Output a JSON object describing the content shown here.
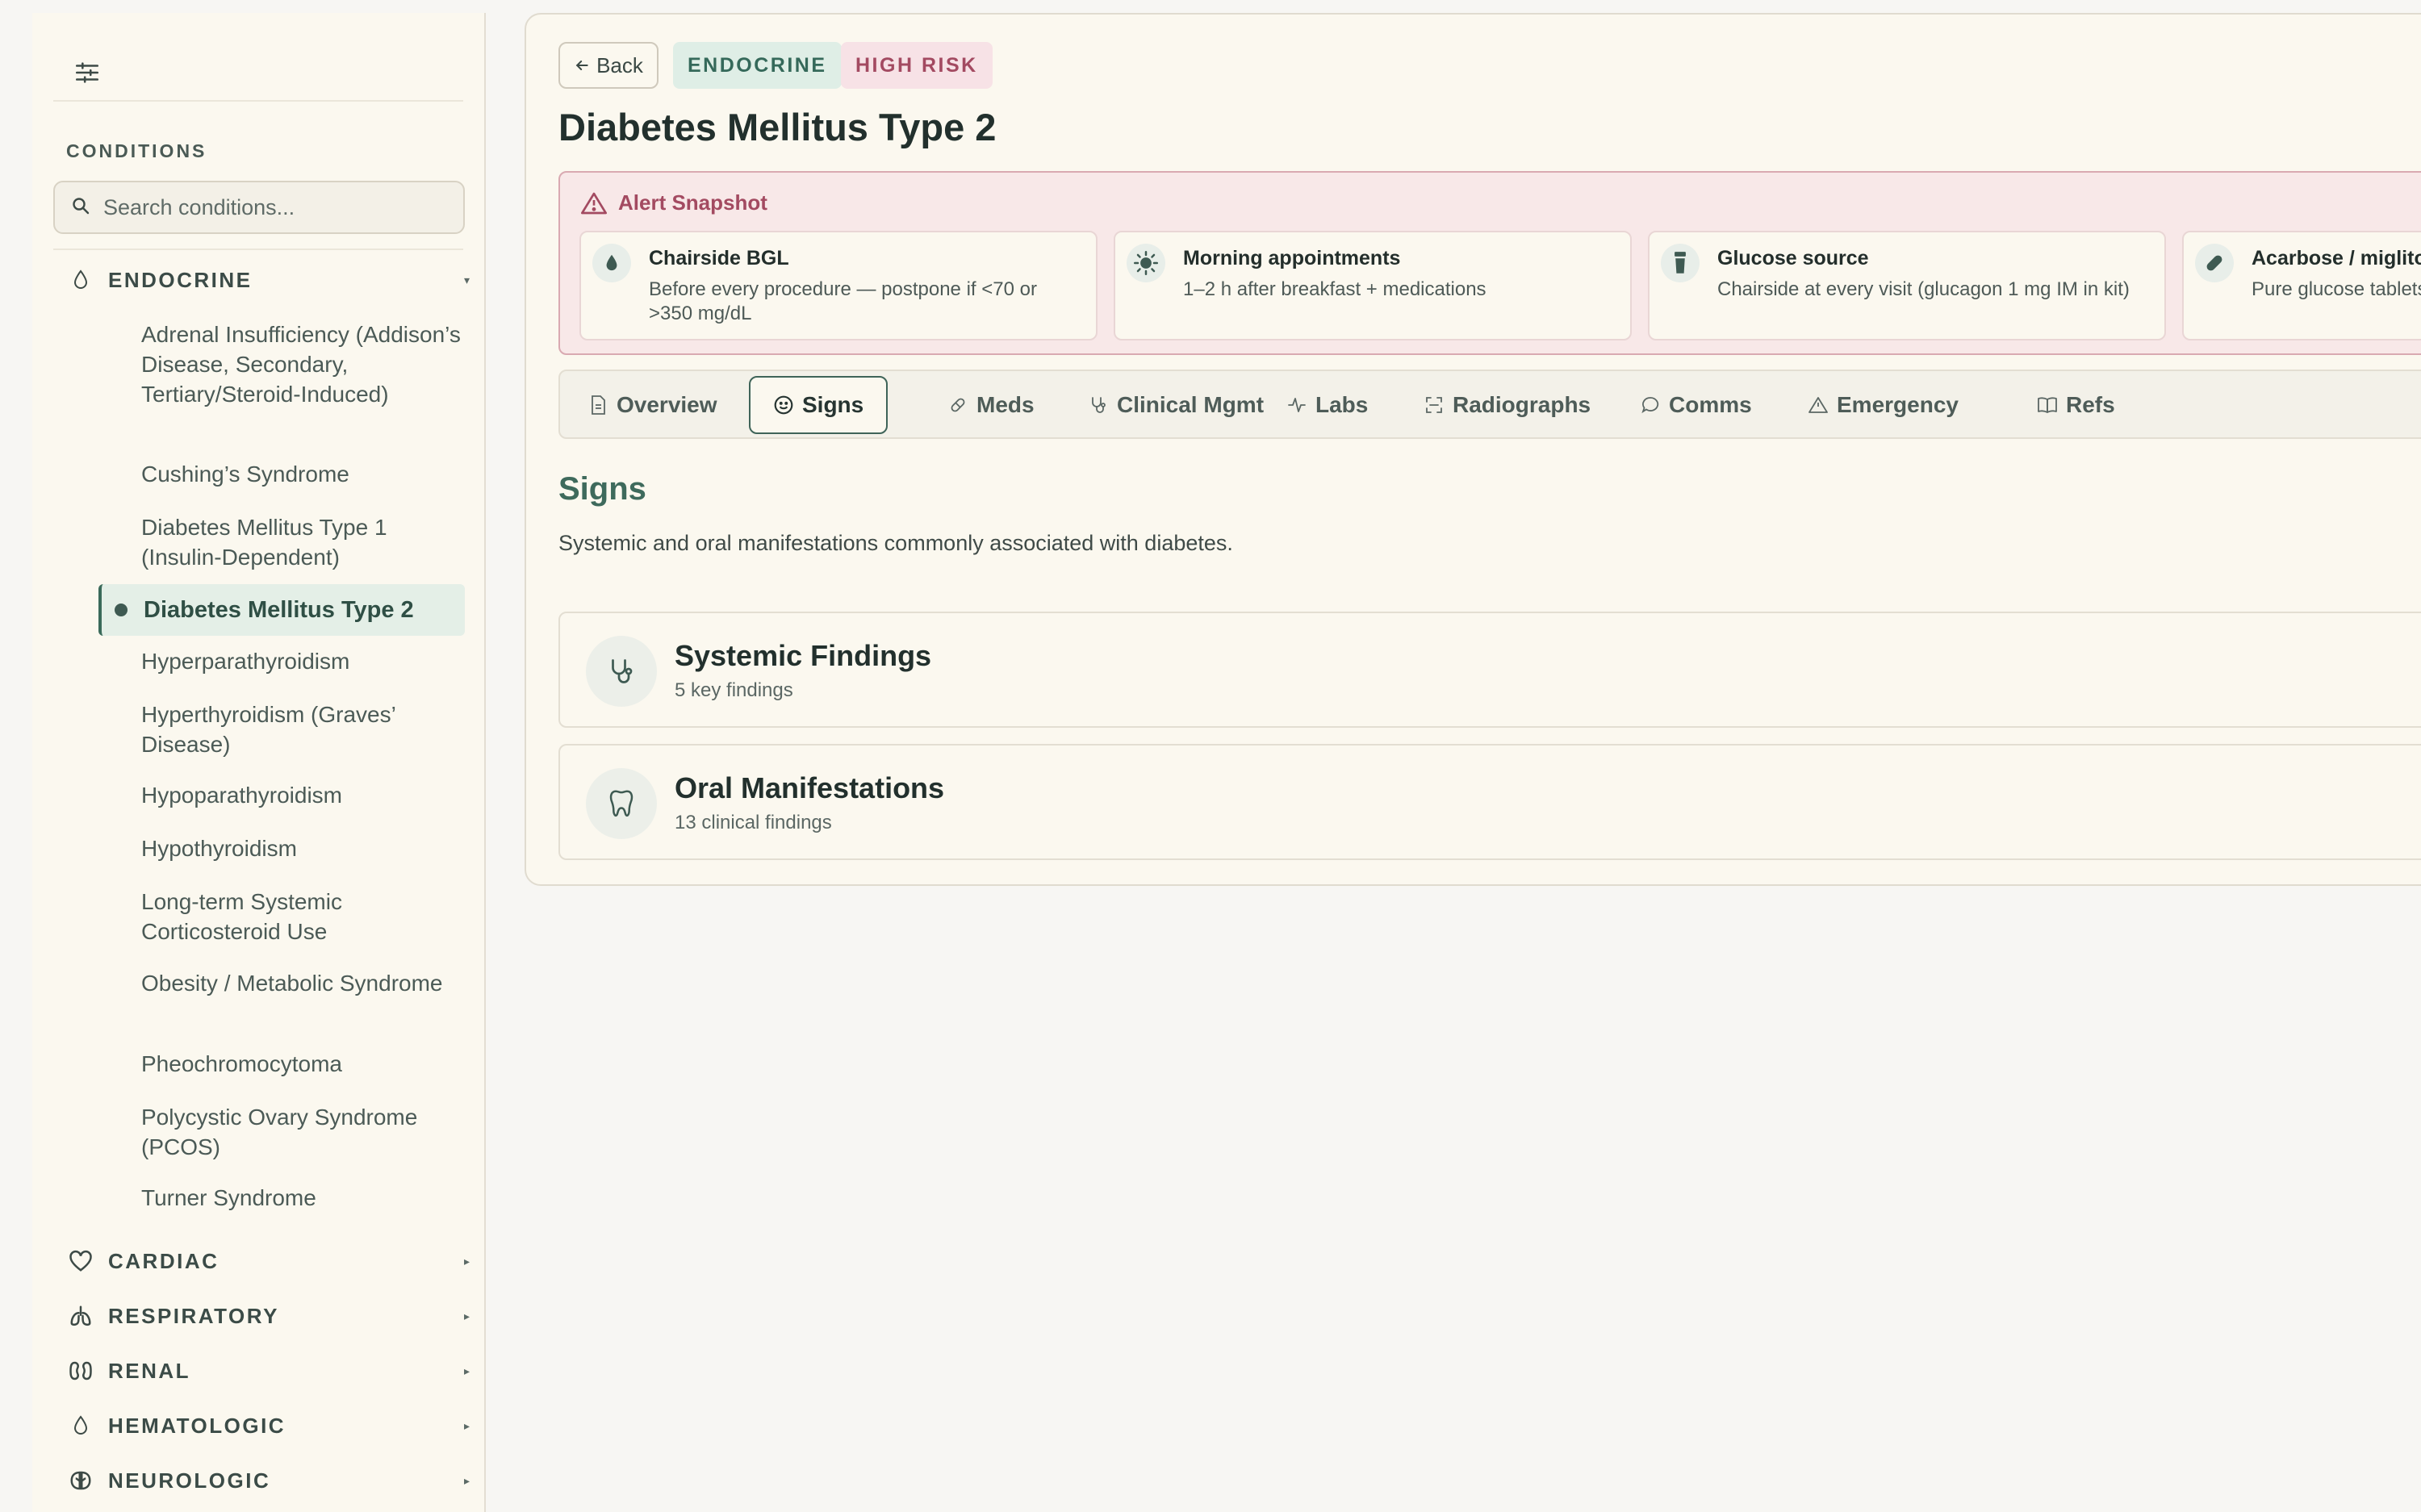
{
  "sidebar": {
    "title": "CONDITIONS",
    "search_placeholder": "Search conditions...",
    "expanded_category": {
      "label": "ENDOCRINE",
      "icon": "droplet-icon"
    },
    "conditions": [
      "Adrenal Insufficiency (Addison’s Disease, Secondary, Tertiary/Steroid-Induced)",
      "Cushing’s Syndrome",
      "Diabetes Mellitus Type 1 (Insulin-Dependent)",
      "Diabetes Mellitus Type 2",
      "Hyperparathyroidism",
      "Hyperthyroidism (Graves’ Disease)",
      "Hypoparathyroidism",
      "Hypothyroidism",
      "Long-term Systemic Corticosteroid Use",
      "Obesity / Metabolic Syndrome",
      "Pheochromocytoma",
      "Polycystic Ovary Syndrome (PCOS)",
      "Turner Syndrome"
    ],
    "active_condition": "Diabetes Mellitus Type 2",
    "collapsed_categories": [
      {
        "label": "CARDIAC",
        "icon": "heart-icon"
      },
      {
        "label": "RESPIRATORY",
        "icon": "lungs-icon"
      },
      {
        "label": "RENAL",
        "icon": "kidney-icon"
      },
      {
        "label": "HEMATOLOGIC",
        "icon": "droplet-icon"
      },
      {
        "label": "NEUROLOGIC",
        "icon": "brain-icon"
      }
    ]
  },
  "header": {
    "back_label": "Back",
    "category_badge": "ENDOCRINE",
    "risk_badge": "HIGH RISK",
    "title": "Diabetes Mellitus Type 2"
  },
  "alert": {
    "heading": "Alert Snapshot",
    "cards": [
      {
        "title": "Chairside BGL",
        "desc": "Before every procedure — postpone if <70 or >350 mg/dL",
        "icon": "droplet-icon"
      },
      {
        "title": "Morning appointments",
        "desc": "1–2 h after breakfast + medications",
        "icon": "sun-icon"
      },
      {
        "title": "Glucose source",
        "desc": "Chairside at every visit (glucagon 1 mg IM in kit)",
        "icon": "glucose-bottle-icon"
      },
      {
        "title": "Acarbose / miglitol",
        "desc": "Pure glucose tablets... not work",
        "icon": "pill-icon"
      }
    ]
  },
  "tabs": [
    {
      "label": "Overview",
      "icon": "document-icon"
    },
    {
      "label": "Signs",
      "icon": "smiley-icon",
      "active": true
    },
    {
      "label": "Meds",
      "icon": "pill-icon"
    },
    {
      "label": "Clinical Mgmt",
      "icon": "stethoscope-icon"
    },
    {
      "label": "Labs",
      "icon": "activity-icon"
    },
    {
      "label": "Radiographs",
      "icon": "scan-icon"
    },
    {
      "label": "Comms",
      "icon": "chat-icon"
    },
    {
      "label": "Emergency",
      "icon": "warning-icon"
    },
    {
      "label": "Refs",
      "icon": "book-icon"
    }
  ],
  "section": {
    "title": "Signs",
    "description": "Systemic and oral manifestations commonly associated with diabetes."
  },
  "findings": [
    {
      "title": "Systemic Findings",
      "subtitle": "5 key findings",
      "icon": "stethoscope-icon"
    },
    {
      "title": "Oral Manifestations",
      "subtitle": "13 clinical findings",
      "icon": "tooth-icon"
    }
  ],
  "colors": {
    "accent": "#3e6a5c",
    "risk": "#a34a61",
    "alert_bg": "#f8e8e8"
  }
}
